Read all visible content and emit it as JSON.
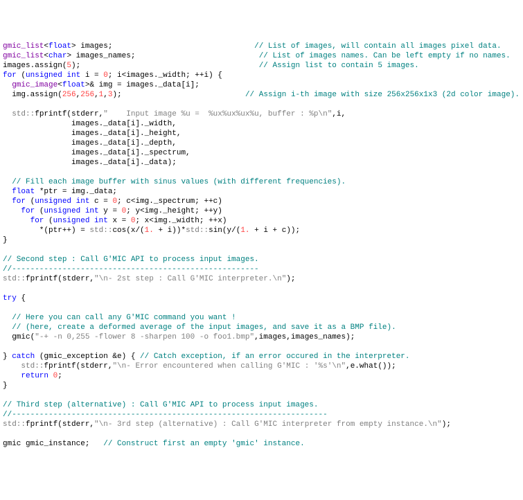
{
  "lines": [
    [
      {
        "c": "type",
        "t": "gmic_list"
      },
      {
        "c": "id",
        "t": "<"
      },
      {
        "c": "kw",
        "t": "float"
      },
      {
        "c": "id",
        "t": "> images;                               "
      },
      {
        "c": "cmt",
        "t": "// List of images, will contain all images pixel data."
      }
    ],
    [
      {
        "c": "type",
        "t": "gmic_list"
      },
      {
        "c": "id",
        "t": "<"
      },
      {
        "c": "kw",
        "t": "char"
      },
      {
        "c": "id",
        "t": "> images_names;                           "
      },
      {
        "c": "cmt",
        "t": "// List of images names. Can be left empty if no names."
      }
    ],
    [
      {
        "c": "id",
        "t": "images.assign("
      },
      {
        "c": "num",
        "t": "5"
      },
      {
        "c": "id",
        "t": ");                                       "
      },
      {
        "c": "cmt",
        "t": "// Assign list to contain 5 images."
      }
    ],
    [
      {
        "c": "kw",
        "t": "for"
      },
      {
        "c": "id",
        "t": " ("
      },
      {
        "c": "kw",
        "t": "unsigned int"
      },
      {
        "c": "id",
        "t": " i = "
      },
      {
        "c": "num",
        "t": "0"
      },
      {
        "c": "id",
        "t": "; i<images._width; ++i) {"
      }
    ],
    [
      {
        "c": "id",
        "t": "  "
      },
      {
        "c": "type",
        "t": "gmic_image"
      },
      {
        "c": "id",
        "t": "<"
      },
      {
        "c": "kw",
        "t": "float"
      },
      {
        "c": "id",
        "t": ">& img = images._data[i];"
      }
    ],
    [
      {
        "c": "id",
        "t": "  img.assign("
      },
      {
        "c": "num",
        "t": "256"
      },
      {
        "c": "id",
        "t": ","
      },
      {
        "c": "num",
        "t": "256"
      },
      {
        "c": "id",
        "t": ","
      },
      {
        "c": "num",
        "t": "1"
      },
      {
        "c": "id",
        "t": ","
      },
      {
        "c": "num",
        "t": "3"
      },
      {
        "c": "id",
        "t": ");                           "
      },
      {
        "c": "cmt",
        "t": "// Assign i-th image with size 256x256x1x3 (2d color image)."
      }
    ],
    [
      {
        "c": "id",
        "t": ""
      }
    ],
    [
      {
        "c": "id",
        "t": "  "
      },
      {
        "c": "std",
        "t": "std::"
      },
      {
        "c": "id",
        "t": "fprintf(stderr,"
      },
      {
        "c": "str",
        "t": "\"    Input image %u =  %ux%ux%ux%u, buffer : %p\\n\""
      },
      {
        "c": "id",
        "t": ",i,"
      }
    ],
    [
      {
        "c": "id",
        "t": "               images._data[i]._width,"
      }
    ],
    [
      {
        "c": "id",
        "t": "               images._data[i]._height,"
      }
    ],
    [
      {
        "c": "id",
        "t": "               images._data[i]._depth,"
      }
    ],
    [
      {
        "c": "id",
        "t": "               images._data[i]._spectrum,"
      }
    ],
    [
      {
        "c": "id",
        "t": "               images._data[i]._data);"
      }
    ],
    [
      {
        "c": "id",
        "t": ""
      }
    ],
    [
      {
        "c": "id",
        "t": "  "
      },
      {
        "c": "cmt",
        "t": "// Fill each image buffer with sinus values (with different frequencies)."
      }
    ],
    [
      {
        "c": "id",
        "t": "  "
      },
      {
        "c": "kw",
        "t": "float"
      },
      {
        "c": "id",
        "t": " *ptr = img._data;"
      }
    ],
    [
      {
        "c": "id",
        "t": "  "
      },
      {
        "c": "kw",
        "t": "for"
      },
      {
        "c": "id",
        "t": " ("
      },
      {
        "c": "kw",
        "t": "unsigned int"
      },
      {
        "c": "id",
        "t": " c = "
      },
      {
        "c": "num",
        "t": "0"
      },
      {
        "c": "id",
        "t": "; c<img._spectrum; ++c)"
      }
    ],
    [
      {
        "c": "id",
        "t": "    "
      },
      {
        "c": "kw",
        "t": "for"
      },
      {
        "c": "id",
        "t": " ("
      },
      {
        "c": "kw",
        "t": "unsigned int"
      },
      {
        "c": "id",
        "t": " y = "
      },
      {
        "c": "num",
        "t": "0"
      },
      {
        "c": "id",
        "t": "; y<img._height; ++y)"
      }
    ],
    [
      {
        "c": "id",
        "t": "      "
      },
      {
        "c": "kw",
        "t": "for"
      },
      {
        "c": "id",
        "t": " ("
      },
      {
        "c": "kw",
        "t": "unsigned int"
      },
      {
        "c": "id",
        "t": " x = "
      },
      {
        "c": "num",
        "t": "0"
      },
      {
        "c": "id",
        "t": "; x<img._width; ++x)"
      }
    ],
    [
      {
        "c": "id",
        "t": "        *(ptr++) = "
      },
      {
        "c": "std",
        "t": "std::"
      },
      {
        "c": "id",
        "t": "cos(x/("
      },
      {
        "c": "num",
        "t": "1."
      },
      {
        "c": "id",
        "t": " + i))*"
      },
      {
        "c": "std",
        "t": "std::"
      },
      {
        "c": "id",
        "t": "sin(y/("
      },
      {
        "c": "num",
        "t": "1."
      },
      {
        "c": "id",
        "t": " + i + c));"
      }
    ],
    [
      {
        "c": "id",
        "t": "}"
      }
    ],
    [
      {
        "c": "id",
        "t": ""
      }
    ],
    [
      {
        "c": "cmt",
        "t": "// Second step : Call G'MIC API to process input images."
      }
    ],
    [
      {
        "c": "cmt",
        "t": "//------------------------------------------------------"
      }
    ],
    [
      {
        "c": "std",
        "t": "std::"
      },
      {
        "c": "id",
        "t": "fprintf(stderr,"
      },
      {
        "c": "str",
        "t": "\"\\n- 2st step : Call G'MIC interpreter.\\n\""
      },
      {
        "c": "id",
        "t": ");"
      }
    ],
    [
      {
        "c": "id",
        "t": ""
      }
    ],
    [
      {
        "c": "kw",
        "t": "try"
      },
      {
        "c": "id",
        "t": " {"
      }
    ],
    [
      {
        "c": "id",
        "t": ""
      }
    ],
    [
      {
        "c": "id",
        "t": "  "
      },
      {
        "c": "cmt",
        "t": "// Here you can call any G'MIC command you want !"
      }
    ],
    [
      {
        "c": "id",
        "t": "  "
      },
      {
        "c": "cmt",
        "t": "// (here, create a deformed average of the input images, and save it as a BMP file)."
      }
    ],
    [
      {
        "c": "id",
        "t": "  gmic("
      },
      {
        "c": "str",
        "t": "\"-+ -n 0,255 -flower 8 -sharpen 100 -o foo1.bmp\""
      },
      {
        "c": "id",
        "t": ",images,images_names);"
      }
    ],
    [
      {
        "c": "id",
        "t": ""
      }
    ],
    [
      {
        "c": "id",
        "t": "} "
      },
      {
        "c": "kw",
        "t": "catch"
      },
      {
        "c": "id",
        "t": " (gmic_exception &e) { "
      },
      {
        "c": "cmt",
        "t": "// Catch exception, if an error occured in the interpreter."
      }
    ],
    [
      {
        "c": "id",
        "t": "    "
      },
      {
        "c": "std",
        "t": "std::"
      },
      {
        "c": "id",
        "t": "fprintf(stderr,"
      },
      {
        "c": "str",
        "t": "\"\\n- Error encountered when calling G'MIC : '%s'\\n\""
      },
      {
        "c": "id",
        "t": ",e.what());"
      }
    ],
    [
      {
        "c": "id",
        "t": "    "
      },
      {
        "c": "kw",
        "t": "return"
      },
      {
        "c": "id",
        "t": " "
      },
      {
        "c": "num",
        "t": "0"
      },
      {
        "c": "id",
        "t": ";"
      }
    ],
    [
      {
        "c": "id",
        "t": "}"
      }
    ],
    [
      {
        "c": "id",
        "t": ""
      }
    ],
    [
      {
        "c": "cmt",
        "t": "// Third step (alternative) : Call G'MIC API to process input images."
      }
    ],
    [
      {
        "c": "cmt",
        "t": "//---------------------------------------------------------------------"
      }
    ],
    [
      {
        "c": "std",
        "t": "std::"
      },
      {
        "c": "id",
        "t": "fprintf(stderr,"
      },
      {
        "c": "str",
        "t": "\"\\n- 3rd step (alternative) : Call G'MIC interpreter from empty instance.\\n\""
      },
      {
        "c": "id",
        "t": ");"
      }
    ],
    [
      {
        "c": "id",
        "t": ""
      }
    ],
    [
      {
        "c": "id",
        "t": "gmic gmic_instance;   "
      },
      {
        "c": "cmt",
        "t": "// Construct first an empty 'gmic' instance."
      }
    ]
  ]
}
